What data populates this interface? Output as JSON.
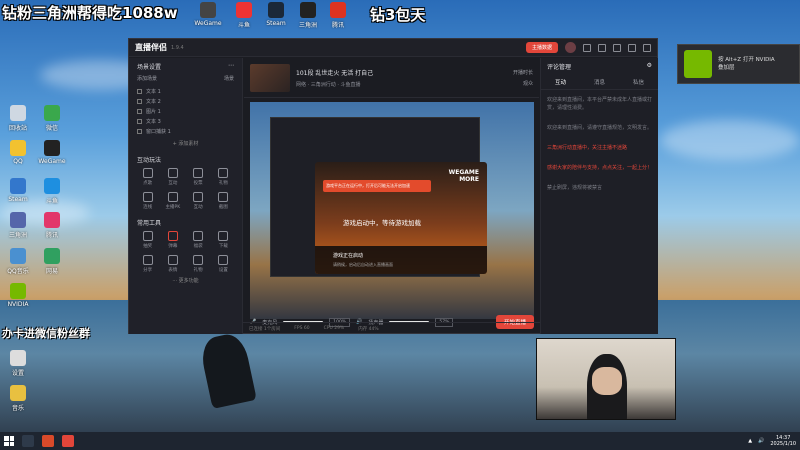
{
  "overlay": {
    "title_left": "钻粉三角洲帮得吃1088w",
    "title_right": "钻3包天",
    "group_text": "办卡进微信粉丝群"
  },
  "app": {
    "name": "直播伴侣",
    "version": "1.9.4",
    "header_button": "主播数据",
    "scenes_title": "场景设置",
    "scene_tabs": [
      "添加场景",
      "场景"
    ],
    "sources": [
      "文本 1",
      "文本 2",
      "图片 1",
      "文本 3",
      "窗口捕获 1"
    ],
    "add_source": "+ 添加素材",
    "interact_title": "互动玩法",
    "interact_tools": [
      "点歌",
      "互动",
      "投票",
      "礼物",
      "连线",
      "主播PK",
      "互动",
      "截图"
    ],
    "common_title": "常用工具",
    "common_tools": [
      "抽奖",
      "弹幕",
      "福袋",
      "下载",
      "分享",
      "表情",
      "礼物",
      "设置"
    ],
    "more_tools": "··· 更多功能",
    "live_title": "101段 乱世走火 无活 打自己",
    "live_sub": "网络 · 三角洲行动 · 斗鱼直播",
    "stats": [
      "开播时长",
      "观众",
      "点赞"
    ],
    "dialog": {
      "banner": "游戏平台正在运行中，打开后可能无法开启加速",
      "brand_line1": "WEGAME",
      "brand_line2": "MORE",
      "message": "游戏启动中，等待游戏加载",
      "foot_title": "游戏正在启动",
      "foot_sub": "请稍候，启动后自动进入直播画面"
    },
    "controls": {
      "mic_label": "麦克风",
      "mic_value": "100%",
      "speaker_label": "扬声器",
      "speaker_value": "57%",
      "start_button": "开始直播"
    },
    "status": [
      "已连接 1个房间",
      "FPS 60",
      "CPU 29%",
      "内存 44%"
    ],
    "right_panel": {
      "title": "评论管理",
      "tabs": [
        "互动",
        "消息",
        "私信"
      ],
      "messages": [
        "欢迎来到直播间，本平台严禁未成年人直播或打赏，请理性消费。",
        "欢迎来到直播间，请遵守直播规范，文明发言。",
        "三角洲行动直播中，关注主播不迷路",
        "感谢大家的陪伴与支持，点点关注，一起上分！",
        "禁止刷屏，违规将被禁言"
      ],
      "highlight_index": 2
    }
  },
  "nvidia": {
    "line1": "按 Alt+Z 打开 NVIDIA",
    "line2": "叠加层"
  },
  "taskbar": {
    "time": "14:37",
    "date": "2025/1/10"
  },
  "desktop_icons": [
    "回收站",
    "微信",
    "QQ",
    "WeGame",
    "Steam",
    "斗鱼",
    "三角洲",
    "腾讯",
    "QQ音乐",
    "网易",
    "浏览器",
    "文件夹",
    "管家",
    "加速器",
    "NVIDIA",
    "设置",
    "控制",
    "音乐"
  ]
}
